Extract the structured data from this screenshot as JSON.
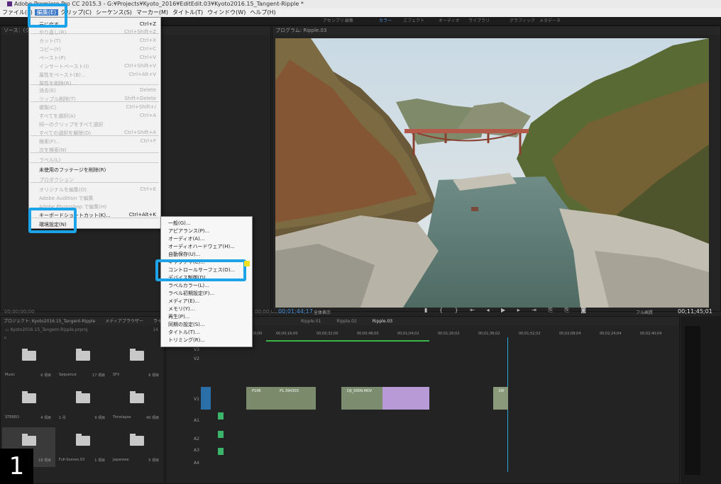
{
  "window": {
    "title": "Adobe Premiere Pro CC 2015.3 - G:¥Projects¥Kyoto_2016¥EditEdit.03¥Kyoto2016.15_Tangent-Ripple *"
  },
  "menubar": [
    "ファイル(F)",
    "編集(E)",
    "クリップ(C)",
    "シーケンス(S)",
    "マーカー(M)",
    "タイトル(T)",
    "ウィンドウ(W)",
    "ヘルプ(H)"
  ],
  "workspaces": [
    "アセンブリ",
    "編集",
    "カラー",
    "エフェクト",
    "オーディオ",
    "ライブラリ",
    "グラフィック",
    "メタデータ"
  ],
  "source": {
    "label": "ソース：(クリップなし)",
    "tc_in": "00;00;00;00",
    "tc_out": "00;00;00;00"
  },
  "program": {
    "label": "プログラム: Ripple.03",
    "timecode": "00;01;44;17",
    "zoom": "全体表示",
    "res": "フル画質",
    "duration": "00;11;45;01"
  },
  "project": {
    "tabs": [
      "プロジェクト: Kyoto2016.15_Tangent-Ripple",
      "メディアブラウザー",
      "ライブラリ"
    ],
    "path": "Kyoto2016.15_Tangent-Ripple.prproj",
    "count": "14",
    "bins": [
      {
        "name": "Music",
        "count": "6 項目"
      },
      {
        "name": "Sequence",
        "count": "17 項目"
      },
      {
        "name": "SFX",
        "count": "6 項目"
      },
      {
        "name": "STEREO",
        "count": "4 項目"
      },
      {
        "name": "1 月",
        "count": "9 項目"
      },
      {
        "name": "Timelapse",
        "count": "40 項目"
      },
      {
        "name": "",
        "count": "18 項目"
      },
      {
        "name": "Full-Scenes.03",
        "count": "1 項目"
      },
      {
        "name": "Japanese",
        "count": "5 項目"
      }
    ]
  },
  "timeline": {
    "tabs": [
      "Ripple.01",
      "Ripple.02",
      "Ripple.03"
    ],
    "ruler": [
      "00;00",
      "00;00;16;00",
      "00;00;32;00",
      "00;00;48;00",
      "00;01;04;02",
      "00;01;20;02",
      "00;01;36;02",
      "00;01;52;02",
      "00;02;08;04",
      "00;02;24;04",
      "00;02;40;04"
    ],
    "tracks": [
      "V3",
      "V2",
      "V1",
      "A1",
      "A2",
      "A3",
      "A4"
    ],
    "clips": [
      "P106",
      "P1",
      "P1",
      "P1",
      "P1",
      "P1.394303",
      "DJI_0009.MOV",
      "D0"
    ]
  },
  "edit_menu": {
    "items": [
      {
        "label": "元に戻す",
        "sc": "Ctrl+Z",
        "dis": false
      },
      {
        "label": "やり直し(R)",
        "sc": "Ctrl+Shift+Z",
        "dis": true
      },
      {
        "label": "カット(T)",
        "sc": "Ctrl+X",
        "dis": true
      },
      {
        "label": "コピー(Y)",
        "sc": "Ctrl+C",
        "dis": true
      },
      {
        "label": "ペースト(P)",
        "sc": "Ctrl+V",
        "dis": true
      },
      {
        "label": "インサートペースト(I)",
        "sc": "Ctrl+Shift+V",
        "dis": true
      },
      {
        "label": "属性をペースト(B)...",
        "sc": "Ctrl+Alt+V",
        "dis": true
      },
      {
        "label": "属性を削除(R)...",
        "sc": "",
        "dis": true
      },
      {
        "label": "消去(E)",
        "sc": "Delete",
        "dis": true
      },
      {
        "label": "リップル削除(T)",
        "sc": "Shift+Delete",
        "dis": true
      },
      {
        "label": "複製(C)",
        "sc": "Ctrl+Shift+/",
        "dis": true
      },
      {
        "label": "すべてを選択(A)",
        "sc": "Ctrl+A",
        "dis": true
      },
      {
        "label": "同一のクリップをすべて選択",
        "sc": "",
        "dis": true
      },
      {
        "label": "すべての選択を解除(D)",
        "sc": "Ctrl+Shift+A",
        "dis": true
      },
      {
        "label": "検索(F)...",
        "sc": "Ctrl+F",
        "dis": true
      },
      {
        "label": "次を検索(N)",
        "sc": "",
        "dis": true
      },
      {
        "label": "ラベル(L)",
        "sc": "",
        "dis": true
      },
      {
        "label": "未使用のフッテージを削除(R)",
        "sc": "",
        "dis": false
      },
      {
        "label": "プロダクション",
        "sc": "",
        "dis": true
      },
      {
        "label": "オリジナルを編集(O)",
        "sc": "Ctrl+E",
        "dis": true
      },
      {
        "label": "Adobe Audition で編集",
        "sc": "",
        "dis": true
      },
      {
        "label": "Adobe Photoshop で編集(H)",
        "sc": "",
        "dis": true
      },
      {
        "label": "キーボードショートカット(K)...",
        "sc": "Ctrl+Alt+K",
        "dis": false
      },
      {
        "label": "環境設定(N)",
        "sc": "",
        "dis": false
      }
    ]
  },
  "pref_menu": [
    "一般(G)...",
    "アピアランス(P)...",
    "オーディオ(A)...",
    "オーディオハードウェア(H)...",
    "自動保存(U)...",
    "キャプチャ(C)...",
    "コントロールサーフェス(O)...",
    "デバイス制御(D)...",
    "ラベルカラー(L)...",
    "ラベル初期設定(F)...",
    "メディア(E)...",
    "メモリ(Y)...",
    "再生(P)...",
    "同期の設定(S)...",
    "タイトル(T)...",
    "トリミング(R)..."
  ],
  "step_badge": "1",
  "highlight_color": "#1ca3e8"
}
